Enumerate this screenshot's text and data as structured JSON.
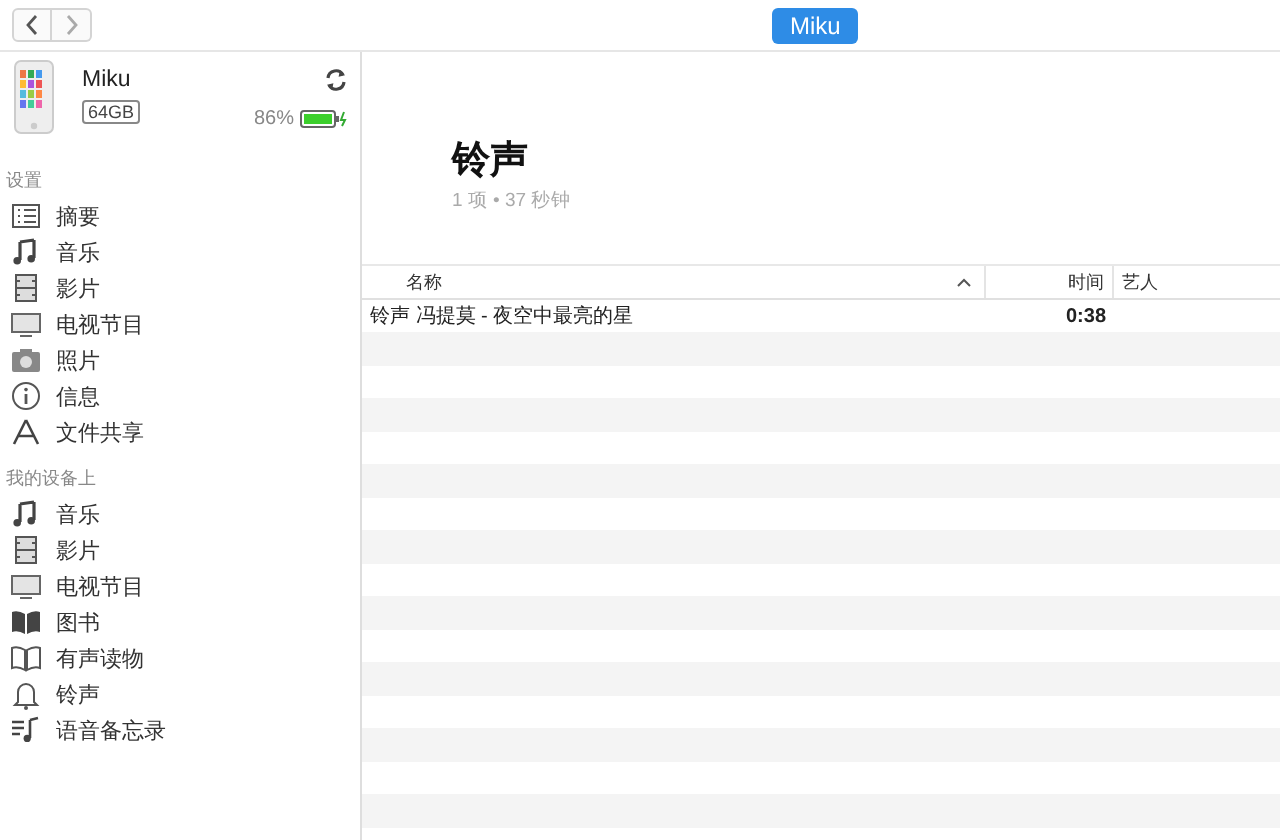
{
  "toolbar": {
    "device_button": "Miku"
  },
  "device": {
    "name": "Miku",
    "capacity": "64GB",
    "battery": "86%"
  },
  "sidebar": [
    {
      "heading": "设置",
      "items": [
        "摘要",
        "音乐",
        "影片",
        "电视节目",
        "照片",
        "信息",
        "文件共享"
      ]
    },
    {
      "heading": "我的设备上",
      "items": [
        "音乐",
        "影片",
        "电视节目",
        "图书",
        "有声读物",
        "铃声",
        "语音备忘录"
      ]
    }
  ],
  "content": {
    "title": "铃声",
    "subtitle": "1 项 • 37 秒钟",
    "table": {
      "columns": [
        "名称",
        "时间",
        "艺人"
      ],
      "rows": [
        {
          "name": "铃声 冯提莫 - 夜空中最亮的星",
          "time": "0:38"
        }
      ]
    }
  }
}
